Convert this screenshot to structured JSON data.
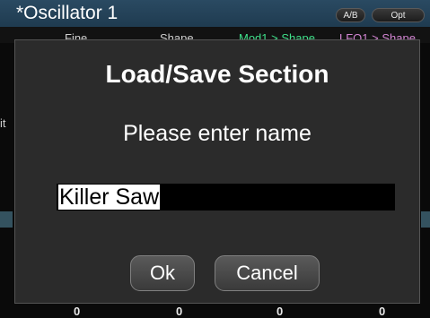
{
  "header": {
    "title": "*Oscillator  1",
    "ab_label": "A/B",
    "opt_label": "Opt"
  },
  "columns": {
    "fine": "Fine",
    "shape": "Shape",
    "mod1": "Mod1 > Shape",
    "lfo1": "LFO1 > Shape"
  },
  "background": {
    "left_fragment": "it",
    "knob_values": [
      "0",
      "0",
      "0",
      "0"
    ]
  },
  "dialog": {
    "title": "Load/Save Section",
    "prompt": "Please enter name",
    "name_value": "Killer Saw",
    "ok_label": "Ok",
    "cancel_label": "Cancel"
  },
  "colors": {
    "header": "#1f3b50",
    "dialog": "#2b2b2b",
    "mod_label": "#3fe08a",
    "lfo_label": "#d486d4"
  }
}
